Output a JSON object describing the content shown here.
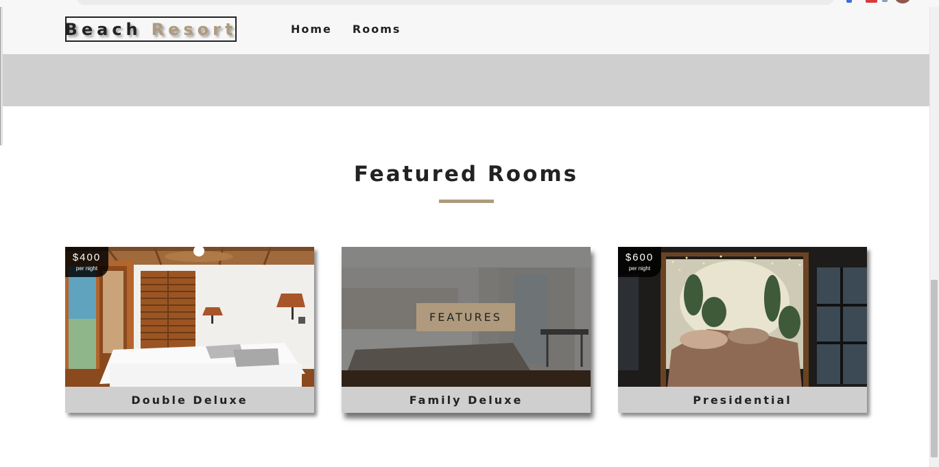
{
  "navbar": {
    "logo_word_1": "Beach",
    "logo_word_2": "Resort",
    "links": [
      {
        "label": "Home"
      },
      {
        "label": "Rooms"
      }
    ]
  },
  "featured": {
    "title": "Featured Rooms",
    "rooms": [
      {
        "name": "Double Deluxe",
        "price": "$400",
        "price_unit": "per night"
      },
      {
        "name": "Family Deluxe",
        "features_label": "FEATURES"
      },
      {
        "name": "Presidential",
        "price": "$600",
        "price_unit": "per night"
      }
    ]
  },
  "colors": {
    "accent": "#af9a7d",
    "text": "#222222",
    "navbar_bg": "#f7f7f7",
    "band_bg": "#cfcfcf",
    "card_footer_bg": "#cfcfcf"
  },
  "icons": [
    "profile-avatar-icon"
  ]
}
